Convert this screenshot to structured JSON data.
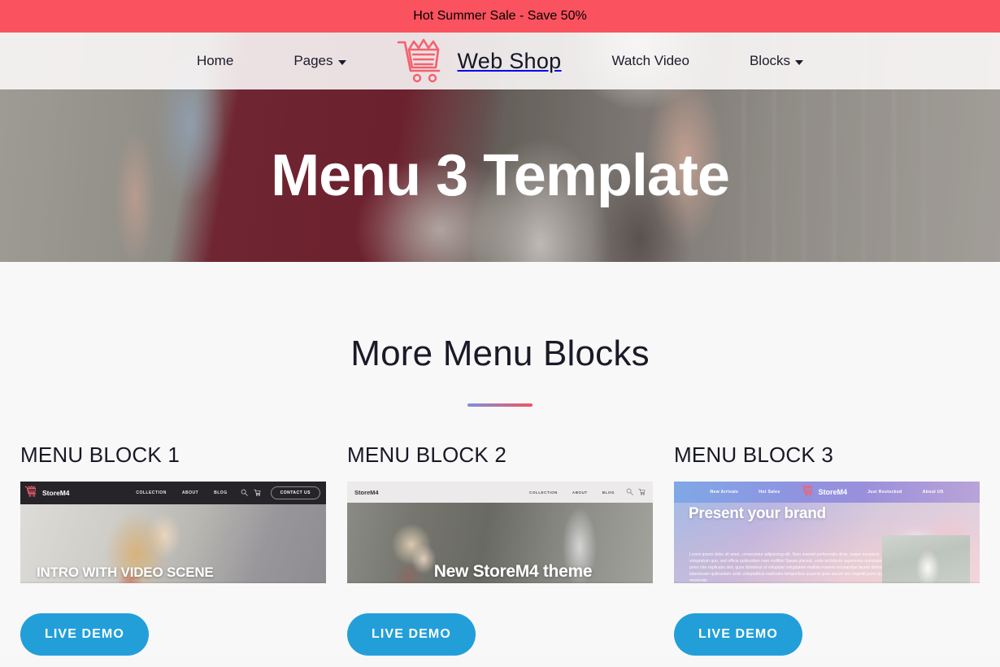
{
  "promo": {
    "text": "Hot Summer Sale - Save 50%",
    "bg_color": "#fa525e"
  },
  "navbar": {
    "left_items": [
      {
        "label": "Home",
        "has_caret": false
      },
      {
        "label": "Pages",
        "has_caret": true
      }
    ],
    "brand": {
      "name": "Web Shop",
      "icon": "shopping-cart-icon",
      "icon_color": "#f4616e"
    },
    "right_items": [
      {
        "label": "Watch Video",
        "has_caret": false
      },
      {
        "label": "Blocks",
        "has_caret": true
      }
    ]
  },
  "hero": {
    "title": "Menu 3 Template"
  },
  "section": {
    "title": "More Menu Blocks",
    "divider_gradient_from": "#7f8fe0",
    "divider_gradient_to": "#f05560"
  },
  "cards": [
    {
      "title": "MENU BLOCK 1",
      "button_label": "LIVE DEMO",
      "preview": {
        "brand": "StoreM4",
        "nav_links": [
          "COLLECTION",
          "ABOUT",
          "BLOG"
        ],
        "icons": [
          "search-icon",
          "cart-icon"
        ],
        "cta": "CONTACT US",
        "hero_text": "INTRO WITH VIDEO SCENE"
      }
    },
    {
      "title": "MENU BLOCK 2",
      "button_label": "LIVE DEMO",
      "preview": {
        "brand": "StoreM4",
        "nav_links": [
          "COLLECTION",
          "ABOUT",
          "BLOG"
        ],
        "icons": [
          "search-icon",
          "cart-icon"
        ],
        "hero_text": "New StoreM4 theme"
      }
    },
    {
      "title": "MENU BLOCK 3",
      "button_label": "LIVE DEMO",
      "preview": {
        "brand": "StoreM4",
        "nav_links_left": [
          "New Arrivals",
          "Hot Sales"
        ],
        "nav_links_right": [
          "Just Restocked",
          "About US"
        ],
        "hero_text": "Present your brand",
        "body_text": "Lorem ipsum dolor sit amet, consectetur adipisicing elit. Nam eveniet perferendis dicta, eaque excepturi, voluptatum quo, sed officia quibusdam nam mollitia! Saepe placeat, unde architecto asperiores numquam ad porro iste explicabo sint, quos doloribus ut voluptate voluptatem mollitia eveniet recusandae facere deleniti laboriosam quibusdam unde voluptatibus explicabo temporibus quaerat quos earum eos impedit porro qui, a id reiciendis."
      }
    }
  ],
  "theme": {
    "button_color": "#229fd9",
    "page_bg": "#f8f8f8"
  }
}
